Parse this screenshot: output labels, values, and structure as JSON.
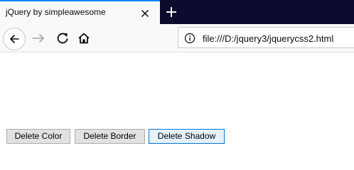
{
  "browser": {
    "tab": {
      "title": "jQuery by simpleawesome"
    },
    "icons": {
      "tab_close": "close-icon",
      "new_tab": "plus-icon",
      "back": "back-arrow-icon",
      "forward": "forward-arrow-icon",
      "reload": "reload-icon",
      "home": "home-icon",
      "site_info": "info-icon"
    },
    "url": "file:///D:/jquery3/jquerycss2.html"
  },
  "page": {
    "buttons": {
      "delete_color": "Delete Color",
      "delete_border": "Delete Border",
      "delete_shadow": "Delete Shadow"
    }
  },
  "colors": {
    "tabstrip": "#0c0c2f",
    "tab_accent": "#0a84ff",
    "toolbar": "#f9f9fa",
    "button_face": "#e1e1e1",
    "button_focus_border": "#0078d7"
  }
}
